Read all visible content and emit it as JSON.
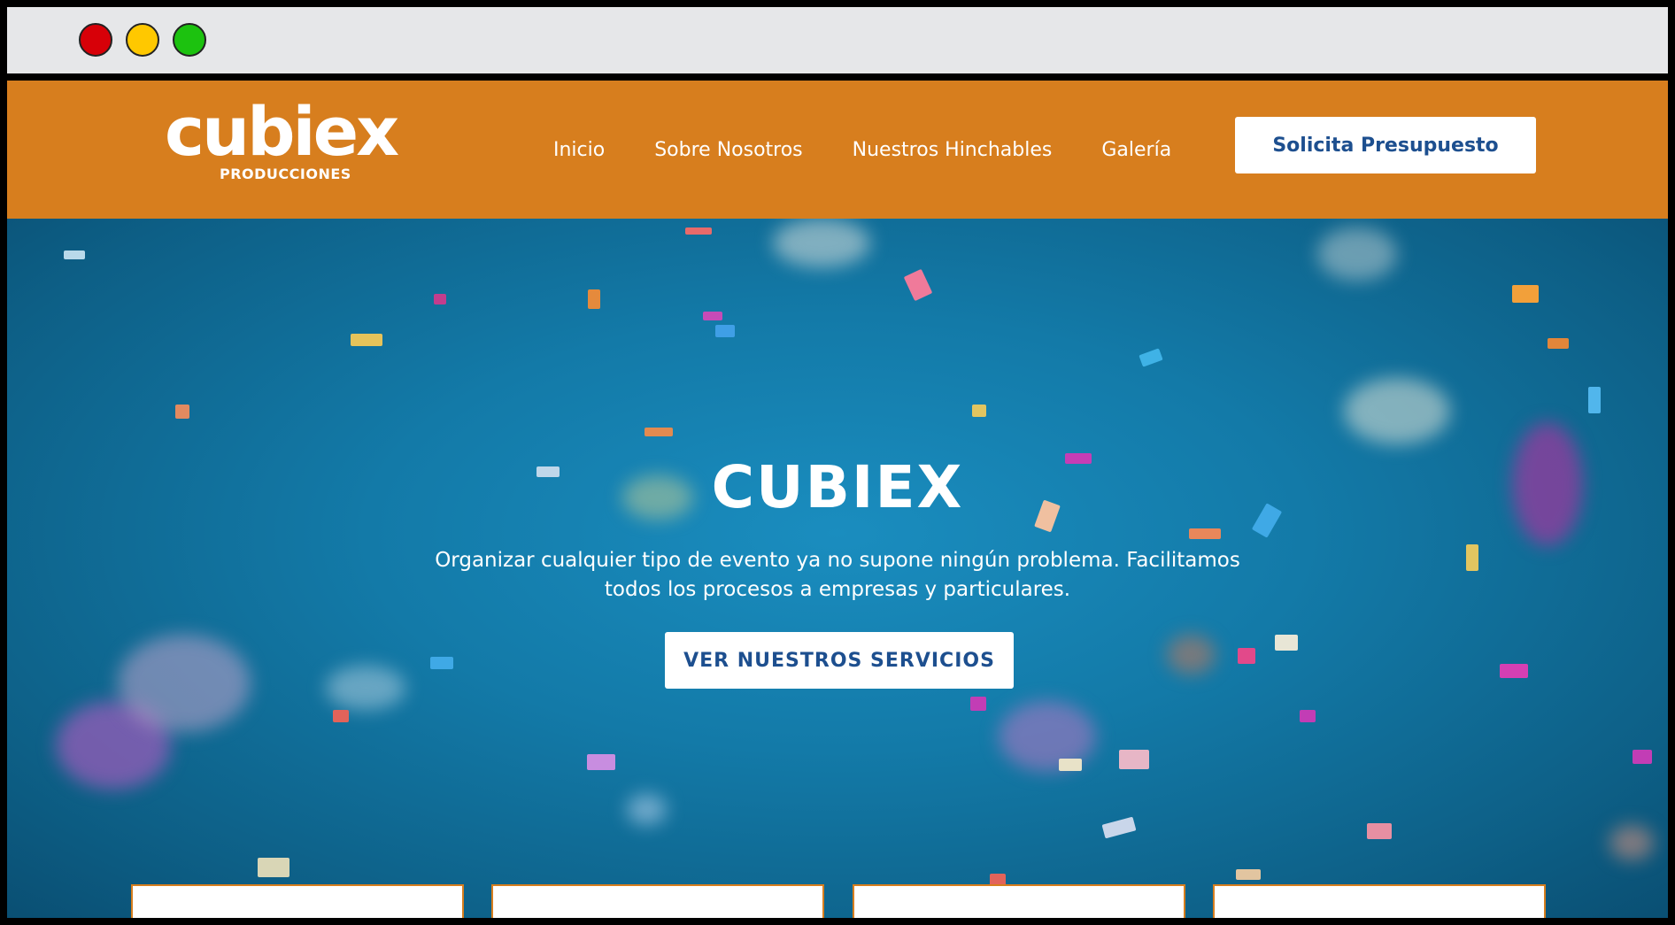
{
  "browser": {
    "controls": [
      "close",
      "minimize",
      "maximize"
    ]
  },
  "header": {
    "logo": {
      "word": "cubiex",
      "sub": "PRODUCCIONES"
    },
    "nav": [
      {
        "label": "Inicio"
      },
      {
        "label": "Sobre Nosotros"
      },
      {
        "label": "Nuestros Hinchables"
      },
      {
        "label": "Galería"
      }
    ],
    "cta_label": "Solicita Presupuesto"
  },
  "hero": {
    "title": "CUBIEX",
    "text": "Organizar cualquier tipo de evento ya no supone ningún problema. Facilitamos todos los procesos a empresas y particulares.",
    "button_label": "VER NUESTROS SERVICIOS"
  },
  "colors": {
    "header_bg": "#d77e1e",
    "accent_text": "#1d4f8f",
    "hero_bg": "#137aa8"
  }
}
